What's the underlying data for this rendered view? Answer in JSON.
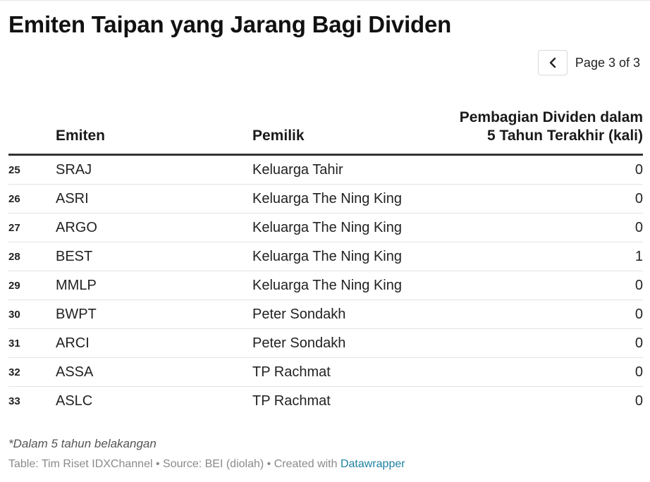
{
  "title": "Emiten Taipan yang Jarang Bagi Dividen",
  "pagination": {
    "label": "Page 3 of 3",
    "prev_icon": "chevron-left-icon"
  },
  "chart_data": {
    "type": "table",
    "columns": [
      "",
      "Emiten",
      "Pemilik",
      "Pembagian Dividen dalam 5 Tahun Terakhir (kali)"
    ],
    "header_dividen_lines": [
      "Pembagian Dividen dalam",
      "5 Tahun Terakhir (kali)"
    ],
    "rows": [
      {
        "no": "25",
        "emiten": "SRAJ",
        "pemilik": "Keluarga Tahir",
        "dividen": 0
      },
      {
        "no": "26",
        "emiten": "ASRI",
        "pemilik": "Keluarga The Ning King",
        "dividen": 0
      },
      {
        "no": "27",
        "emiten": "ARGO",
        "pemilik": "Keluarga The Ning King",
        "dividen": 0
      },
      {
        "no": "28",
        "emiten": "BEST",
        "pemilik": "Keluarga The Ning King",
        "dividen": 1
      },
      {
        "no": "29",
        "emiten": "MMLP",
        "pemilik": "Keluarga The Ning King",
        "dividen": 0
      },
      {
        "no": "30",
        "emiten": "BWPT",
        "pemilik": "Peter Sondakh",
        "dividen": 0
      },
      {
        "no": "31",
        "emiten": "ARCI",
        "pemilik": "Peter Sondakh",
        "dividen": 0
      },
      {
        "no": "32",
        "emiten": "ASSA",
        "pemilik": "TP Rachmat",
        "dividen": 0
      },
      {
        "no": "33",
        "emiten": "ASLC",
        "pemilik": "TP Rachmat",
        "dividen": 0
      }
    ]
  },
  "note": "*Dalam 5 tahun belakangan",
  "footer": {
    "text": "Table: Tim Riset IDXChannel • Source: BEI (diolah) • Created with ",
    "link": "Datawrapper"
  },
  "colors": {
    "link": "#1d81a2",
    "rule": "#333333"
  }
}
